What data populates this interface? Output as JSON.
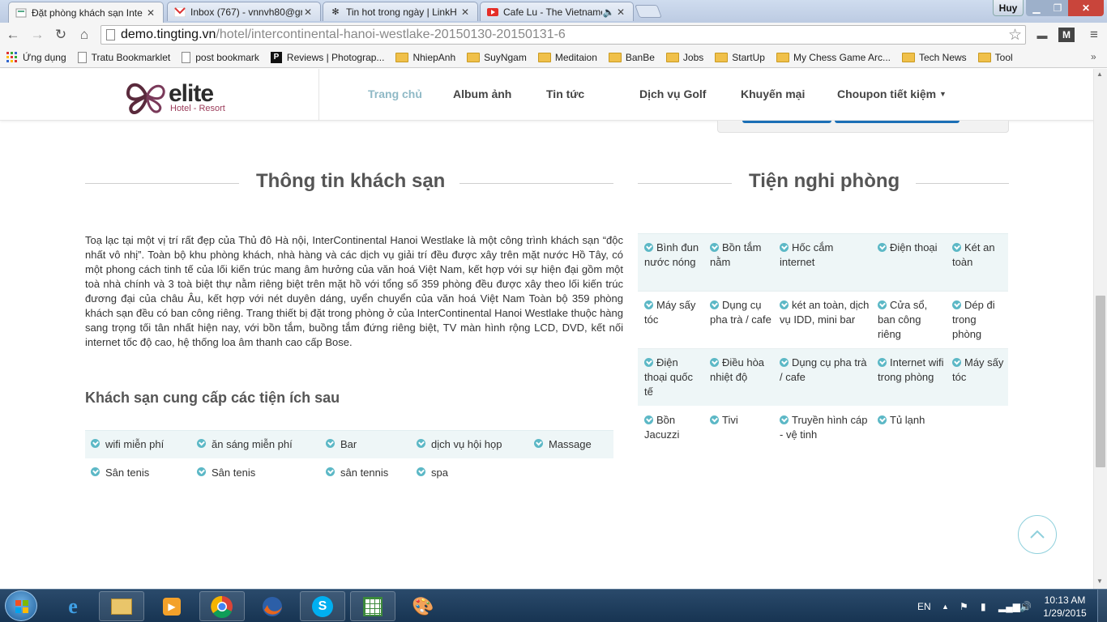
{
  "browser": {
    "tabs": [
      {
        "title": "Đặt phòng khách sạn Inte",
        "icon": "tingting-favicon-icon",
        "active": true
      },
      {
        "title": "Inbox (767) - vnnvh80@gr",
        "icon": "gmail-icon"
      },
      {
        "title": "Tin hot trong ngày | LinkH",
        "icon": "linkhay-icon"
      },
      {
        "title": "Cafe Lu - The Vietname",
        "icon": "youtube-icon",
        "audio": true
      }
    ],
    "user": "Huy",
    "url_host": "demo.tingting.vn",
    "url_path": "/hotel/intercontinental-hanoi-westlake-20150130-20150131-6",
    "bookmarks": [
      {
        "label": "Ứng dụng",
        "icon": "apps-grid-icon"
      },
      {
        "label": "Tratu Bookmarklet",
        "icon": "page-icon"
      },
      {
        "label": "post bookmark",
        "icon": "page-icon"
      },
      {
        "label": "Reviews | Photograp...",
        "icon": "petapixel-icon"
      },
      {
        "label": "NhiepAnh",
        "icon": "folder-icon"
      },
      {
        "label": "SuyNgam",
        "icon": "folder-icon"
      },
      {
        "label": "Meditaion",
        "icon": "folder-icon"
      },
      {
        "label": "BanBe",
        "icon": "folder-icon"
      },
      {
        "label": "Jobs",
        "icon": "folder-icon"
      },
      {
        "label": "StartUp",
        "icon": "folder-icon"
      },
      {
        "label": "My Chess Game Arc...",
        "icon": "folder-icon"
      },
      {
        "label": "Tech News",
        "icon": "folder-icon"
      },
      {
        "label": "Tool",
        "icon": "folder-icon"
      }
    ]
  },
  "site": {
    "logo_text": "elite",
    "logo_sub": "Hotel - Resort",
    "nav": [
      {
        "label": "Trang chủ",
        "active": true
      },
      {
        "label": "Album ảnh"
      },
      {
        "label": "Tin tức"
      },
      {
        "label": "Dịch vụ Golf"
      },
      {
        "label": "Khuyến mại"
      },
      {
        "label": "Choupon tiết kiệm",
        "dropdown": true
      }
    ]
  },
  "hotel_info": {
    "title": "Thông tin khách sạn",
    "description": "Toạ lạc tại một vị trí rất đẹp của Thủ đô Hà nội, InterContinental Hanoi Westlake là một công trình khách sạn “độc nhất vô nhị”. Toàn bộ khu phòng khách, nhà hàng và các dịch vụ giải trí đều được xây trên mặt nước Hồ Tây, có một phong cách tinh tế của lối kiến trúc mang âm hưởng của văn hoá Việt Nam, kết hợp với sự hiện đại gồm một toà nhà chính và 3 toà biệt thự nằm riêng biệt trên mặt hồ với tổng số 359 phòng đều được xây theo lối kiến trúc đương đại của châu Âu, kết hợp với nét duyên dáng, uyển chuyển của văn hoá Việt Nam Toàn bộ 359 phòng khách sạn đều có ban công riêng. Trang thiết bị đặt trong phòng ở của InterContinental Hanoi Westlake thuộc hàng sang trọng tối tân nhất hiện nay, với bồn tắm, buồng tắm đứng riêng biệt, TV màn hình rộng LCD, DVD, kết nối internet tốc độ cao, hệ thống loa âm thanh cao cấp Bose.",
    "facilities_title": "Khách sạn cung cấp các tiện ích sau",
    "facilities": [
      [
        "wifi miễn phí",
        "ăn sáng miễn phí",
        "Bar",
        "dịch vụ hội họp",
        "Massage"
      ],
      [
        "Sân tenis",
        "Sân tenis",
        "sân tennis",
        "spa"
      ]
    ]
  },
  "room_amenities": {
    "title": "Tiện nghi phòng",
    "rows": [
      [
        "Bình đun nước nóng",
        "Bồn tắm nằm",
        "Hốc cắm internet",
        "Điện thoại",
        "Két an toàn"
      ],
      [
        "Máy sấy tóc",
        "Dụng cụ pha trà / cafe",
        "két an toàn, dịch vụ IDD, mini bar",
        "Cửa sổ, ban công riêng",
        "Dép đi trong phòng"
      ],
      [
        "Điện thoại quốc tế",
        "Điều hòa nhiệt độ",
        "Dụng cụ pha trà / cafe",
        "Internet wifi trong phòng",
        "Máy sấy tóc"
      ],
      [
        "Bồn Jacuzzi",
        "Tivi",
        "Truyền hình cáp - vệ tinh",
        "Tủ lạnh"
      ]
    ]
  },
  "taskbar": {
    "lang": "EN",
    "time": "10:13 AM",
    "date": "1/29/2015"
  },
  "colors": {
    "accent": "#5cb8c6",
    "nav_active": "#8fb9c6",
    "row_bg": "#eef6f7"
  }
}
